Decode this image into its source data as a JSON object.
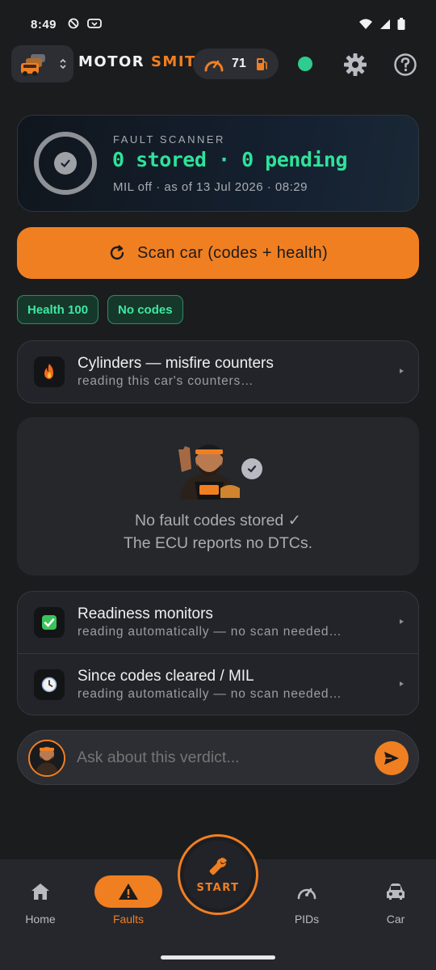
{
  "status_bar": {
    "time": "8:49"
  },
  "header": {
    "brand_left": "MOTOR",
    "brand_right": "SMITH",
    "health_score": "71",
    "connection_color": "#2ecc8f"
  },
  "scanner": {
    "label": "FAULT SCANNER",
    "count_text": "0 stored · 0 pending",
    "sub_text": "MIL off · as of 13 Jul 2026 · 08:29"
  },
  "scan_button": {
    "label": "Scan car (codes + health)"
  },
  "chips": [
    "Health 100",
    "No codes"
  ],
  "cylinders": {
    "title": "Cylinders — misfire counters",
    "subtitle": "reading this car's counters…"
  },
  "empty_state": {
    "title": "No fault codes stored ✓",
    "subtitle": "The ECU reports no DTCs."
  },
  "monitors": [
    {
      "title": "Readiness monitors",
      "subtitle": "reading automatically — no scan needed…"
    },
    {
      "title": "Since codes cleared / MIL",
      "subtitle": "reading automatically — no scan needed…"
    }
  ],
  "ask": {
    "placeholder": "Ask about this verdict..."
  },
  "nav": {
    "home": "Home",
    "faults": "Faults",
    "start": "START",
    "pids": "PIDs",
    "car": "Car"
  },
  "colors": {
    "accent": "#f07f22",
    "success": "#2ee29a",
    "background": "#1b1c1e"
  }
}
